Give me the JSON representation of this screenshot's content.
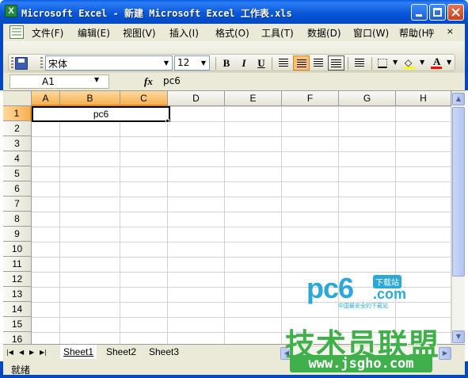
{
  "window": {
    "title": "Microsoft Excel - 新建 Microsoft Excel 工作表.xls",
    "app_icon": "excel-icon",
    "controls": {
      "minimize": "_",
      "maximize": "□",
      "close": "✕"
    }
  },
  "menu": {
    "items": [
      {
        "label": "文件(F)"
      },
      {
        "label": "编辑(E)"
      },
      {
        "label": "视图(V)"
      },
      {
        "label": "插入(I)"
      },
      {
        "label": "格式(O)"
      },
      {
        "label": "工具(T)"
      },
      {
        "label": "数据(D)"
      },
      {
        "label": "窗口(W)"
      },
      {
        "label": "帮助(H)"
      }
    ],
    "window_controls": "_ ▫ ×"
  },
  "toolbar": {
    "font_name": "宋体",
    "font_size": "12",
    "bold": "B",
    "italic": "I",
    "underline": "U",
    "active_alignment": "center"
  },
  "formula_bar": {
    "name_box": "A1",
    "fx": "fx",
    "formula": "pc6"
  },
  "grid": {
    "columns": [
      "A",
      "B",
      "C",
      "D",
      "E",
      "F",
      "G",
      "H"
    ],
    "selected_columns": [
      "A",
      "B",
      "C"
    ],
    "rows": [
      "1",
      "2",
      "3",
      "4",
      "5",
      "6",
      "7",
      "8",
      "9",
      "10",
      "11",
      "12",
      "13",
      "14",
      "15",
      "16"
    ],
    "selected_row": "1",
    "merged_cell": {
      "range": "A1:C1",
      "value": "pc6"
    }
  },
  "sheets": {
    "tabs": [
      "Sheet1",
      "Sheet2",
      "Sheet3"
    ],
    "active": "Sheet1"
  },
  "status": {
    "text": "就绪"
  },
  "watermarks": {
    "pc6_main": "pc6",
    "pc6_badge": "下载站",
    "pc6_com": ".com",
    "pc6_sub": "中国最安全的下载站",
    "jsgho_cn": "技术员联盟",
    "jsgho_url": "www.jsgho.com"
  },
  "colors": {
    "titlebar": "#0a58d8",
    "selection_header": "#f7b153",
    "watermark_green": "#3fb04a",
    "watermark_blue": "#2ba7d8"
  }
}
